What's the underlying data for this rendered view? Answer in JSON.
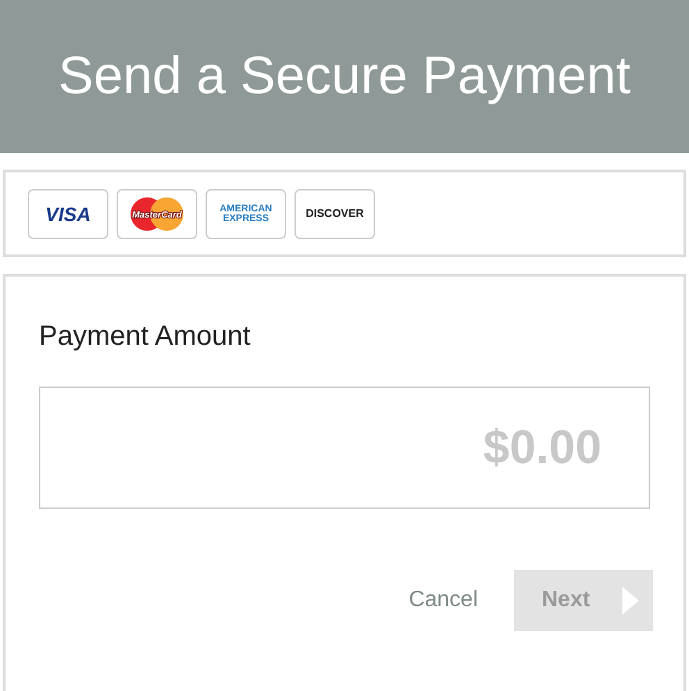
{
  "header": {
    "title": "Send a Secure Payment"
  },
  "cards": [
    {
      "kind": "visa",
      "text": "VISA"
    },
    {
      "kind": "mastercard",
      "text": "MasterCard"
    },
    {
      "kind": "amex",
      "lines": [
        "AMERICAN",
        "EXPRESS"
      ]
    },
    {
      "kind": "discover",
      "text": "DISCOVER"
    }
  ],
  "form": {
    "label": "Payment Amount",
    "amount": {
      "placeholder": "$0.00"
    }
  },
  "buttons": {
    "cancel": {
      "label": "Cancel"
    },
    "next": {
      "label": "Next",
      "disabled": true
    }
  }
}
